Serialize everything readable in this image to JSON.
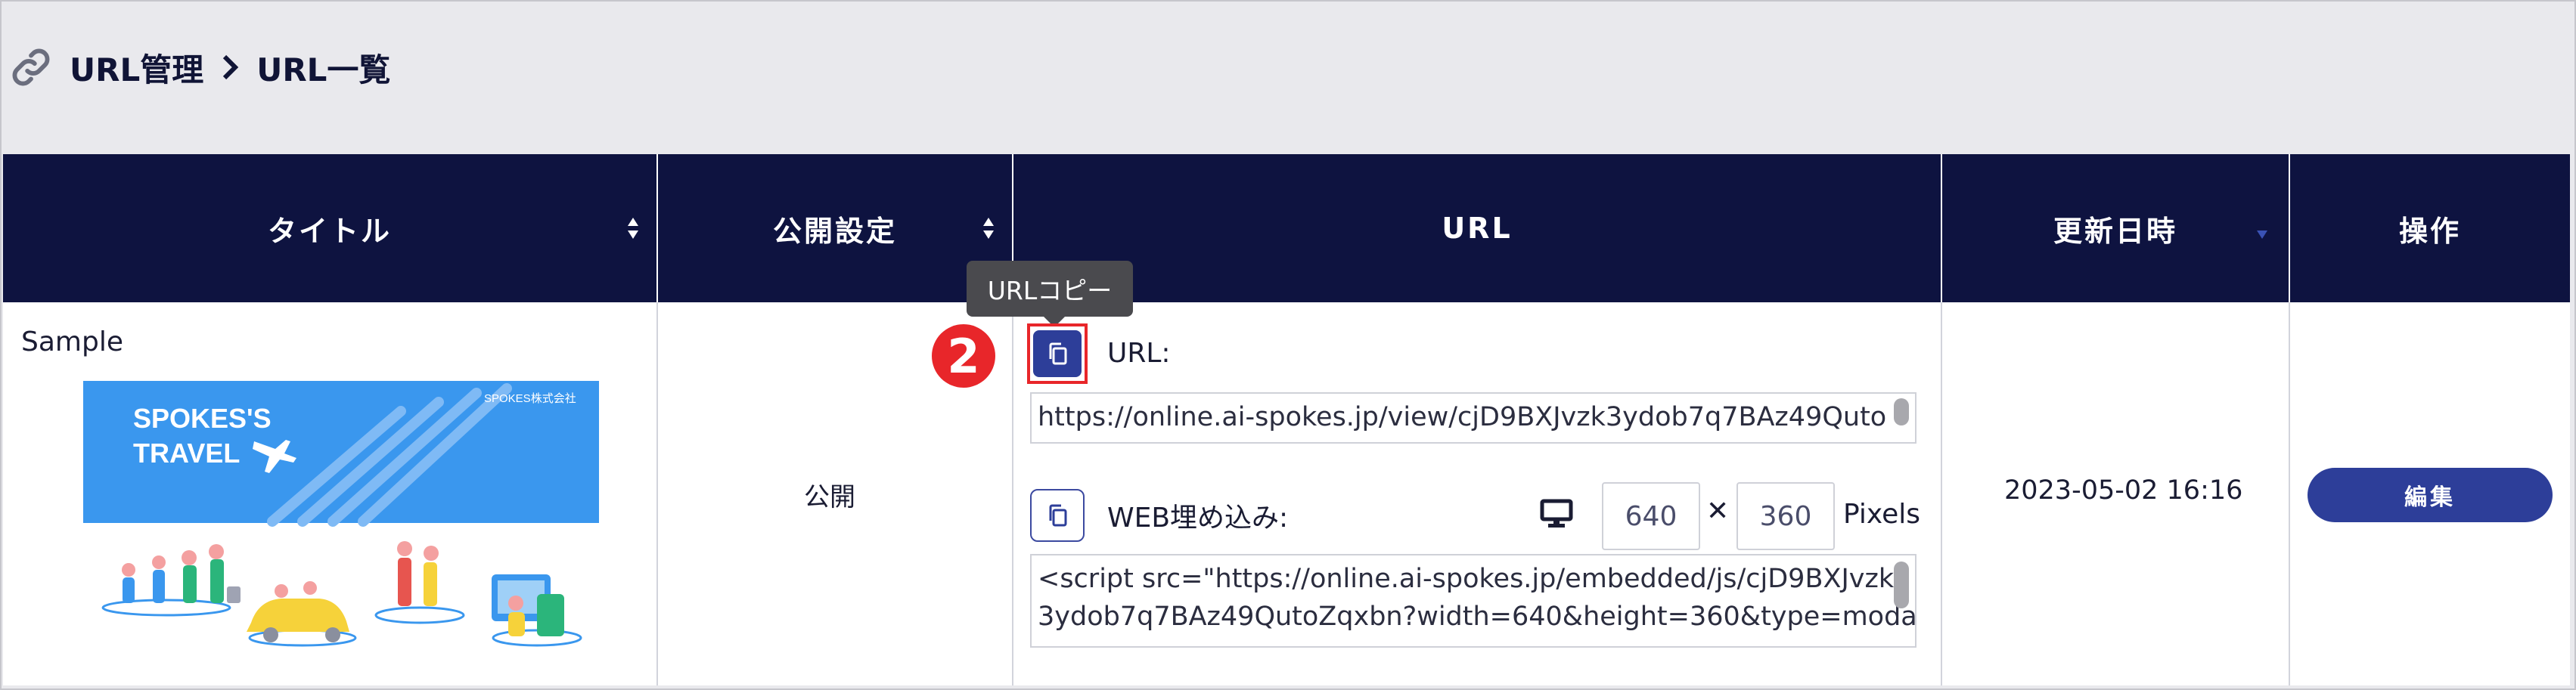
{
  "breadcrumb": {
    "section": "URL管理",
    "page": "URL一覧"
  },
  "table": {
    "headers": {
      "title": "タイトル",
      "publish": "公開設定",
      "url": "URL",
      "updated": "更新日時",
      "actions": "操作"
    },
    "row": {
      "title": "Sample",
      "thumbnail": {
        "heading_line1": "SPOKES'S",
        "heading_line2": "TRAVEL",
        "company": "SPOKES株式会社"
      },
      "publish": "公開",
      "url_label": "URL:",
      "url_value": "https://online.ai-spokes.jp/view/cjD9BXJvzk3ydob7q7BAz49Quto",
      "embed_label": "WEB埋め込み:",
      "width": "640",
      "times": "✕",
      "height": "360",
      "pixels_label": "Pixels",
      "embed_code": "<script src=\"https://online.ai-spokes.jp/embedded/js/cjD9BXJvzk\n3ydob7q7BAz49QutoZqxbn?width=640&height=360&type=moda",
      "updated": "2023-05-02 16:16",
      "edit_label": "編集"
    }
  },
  "tooltip": "URLコピー",
  "step_badge": "2",
  "colors": {
    "header_bg": "#0e1340",
    "primary": "#2d3e99",
    "highlight": "#e8262a",
    "thumb_blue": "#3a97ee"
  },
  "icons": [
    "link-icon",
    "chevron-right-icon",
    "sort-icon",
    "sort-desc-icon",
    "copy-icon",
    "monitor-icon"
  ]
}
